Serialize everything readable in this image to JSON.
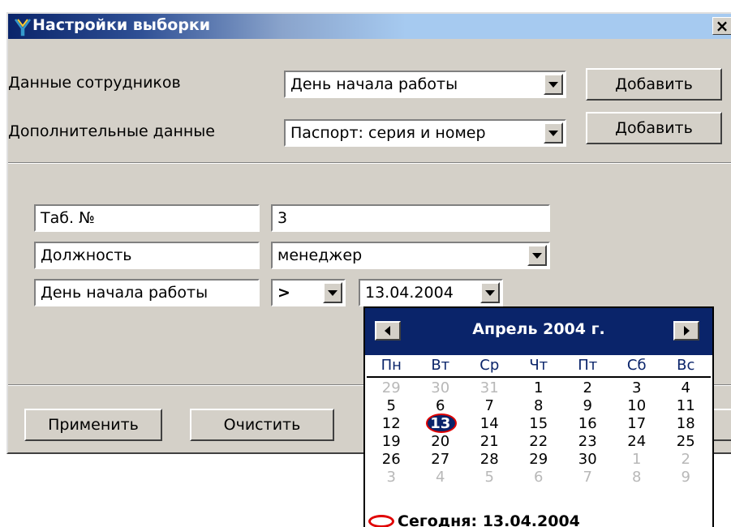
{
  "window": {
    "title": "Настройки выборки",
    "close_label": "×"
  },
  "employee_data": {
    "label": "Данные сотрудников",
    "selected": "День начала работы",
    "add_label": "Добавить"
  },
  "extra_data": {
    "label": "Дополнительные данные",
    "selected": "Паспорт: серия и номер",
    "add_label": "Добавить"
  },
  "filters": {
    "tab_no": {
      "label": "Таб. №",
      "value": "3"
    },
    "position": {
      "label": "Должность",
      "value": "менеджер"
    },
    "start_day": {
      "label": "День начала работы",
      "operator": ">",
      "date": "13.04.2004"
    }
  },
  "footer": {
    "apply_label": "Применить",
    "clear_label": "Очистить"
  },
  "calendar": {
    "title": "Апрель 2004 г.",
    "weekdays": [
      "Пн",
      "Вт",
      "Ср",
      "Чт",
      "Пт",
      "Сб",
      "Вс"
    ],
    "weeks": [
      [
        "29",
        "30",
        "31",
        "1",
        "2",
        "3",
        "4"
      ],
      [
        "5",
        "6",
        "7",
        "8",
        "9",
        "10",
        "11"
      ],
      [
        "12",
        "13",
        "14",
        "15",
        "16",
        "17",
        "18"
      ],
      [
        "19",
        "20",
        "21",
        "22",
        "23",
        "24",
        "25"
      ],
      [
        "26",
        "27",
        "28",
        "29",
        "30",
        "1",
        "2"
      ],
      [
        "3",
        "4",
        "5",
        "6",
        "7",
        "8",
        "9"
      ]
    ],
    "selected_day": "13",
    "today_text": "Сегодня: 13.04.2004"
  },
  "colors": {
    "window_bg": "#d4d0c8",
    "title_bar": "#0a246a",
    "today_circle": "#e00000"
  }
}
